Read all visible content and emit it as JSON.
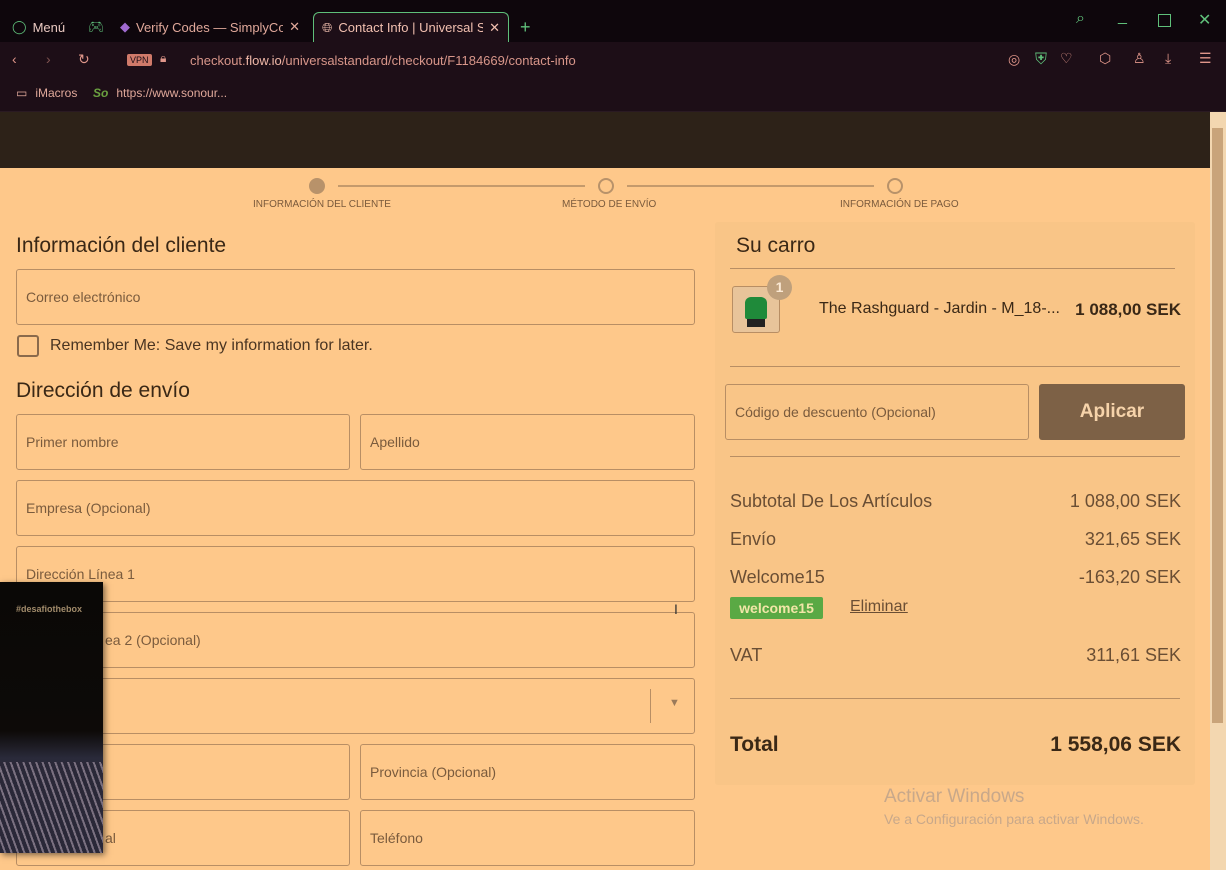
{
  "browser": {
    "menu": "Menú",
    "tabs": [
      {
        "title": "Verify Codes — SimplyCodes"
      },
      {
        "title": "Contact Info | Universal Standard"
      }
    ],
    "url_prefix": "checkout.",
    "url_domain": "flow.io",
    "url_path": "/universalstandard/checkout/F1184669/contact-info",
    "vpn": "VPN",
    "bookmarks": [
      {
        "label": "iMacros"
      },
      {
        "label": "https://www.sonour..."
      }
    ]
  },
  "steps": [
    {
      "label": "INFORMACIÓN DEL CLIENTE",
      "done": true
    },
    {
      "label": "MÉTODO DE ENVÍO",
      "done": false
    },
    {
      "label": "INFORMACIÓN DE PAGO",
      "done": false
    }
  ],
  "form": {
    "title": "Información del cliente",
    "email": "Correo electrónico",
    "remember": "Remember Me: Save my information for later.",
    "shipping_title": "Dirección de envío",
    "first_name": "Primer nombre",
    "last_name": "Apellido",
    "company": "Empresa (Opcional)",
    "address1": "Dirección Línea 1",
    "address2_visible": "ea 2 (Opcional)",
    "province": "Provincia (Opcional)",
    "postal_visible": "al",
    "phone": "Teléfono"
  },
  "video_overlay": {
    "caption": "#desafiothebox"
  },
  "cart": {
    "title": "Su carro",
    "item": {
      "qty": "1",
      "name": "The Rashguard - Jardin - M_18-...",
      "price": "1 088,00 SEK"
    },
    "discount_placeholder": "Código de descuento (Opcional)",
    "apply": "Aplicar",
    "subtotal_label": "Subtotal De Los Artículos",
    "subtotal": "1 088,00 SEK",
    "shipping_label": "Envío",
    "shipping": "321,65 SEK",
    "discount_label": "Welcome15",
    "discount": "-163,20 SEK",
    "code_badge": "welcome15",
    "remove": "Eliminar",
    "vat_label": "VAT",
    "vat": "311,61 SEK",
    "total_label": "Total",
    "total": "1 558,06 SEK"
  },
  "watermark": {
    "title": "Activar Windows",
    "subtitle": "Ve a Configuración para activar Windows."
  },
  "colors": {
    "accent_green": "#5aa944",
    "apply_btn": "#7d6146"
  }
}
